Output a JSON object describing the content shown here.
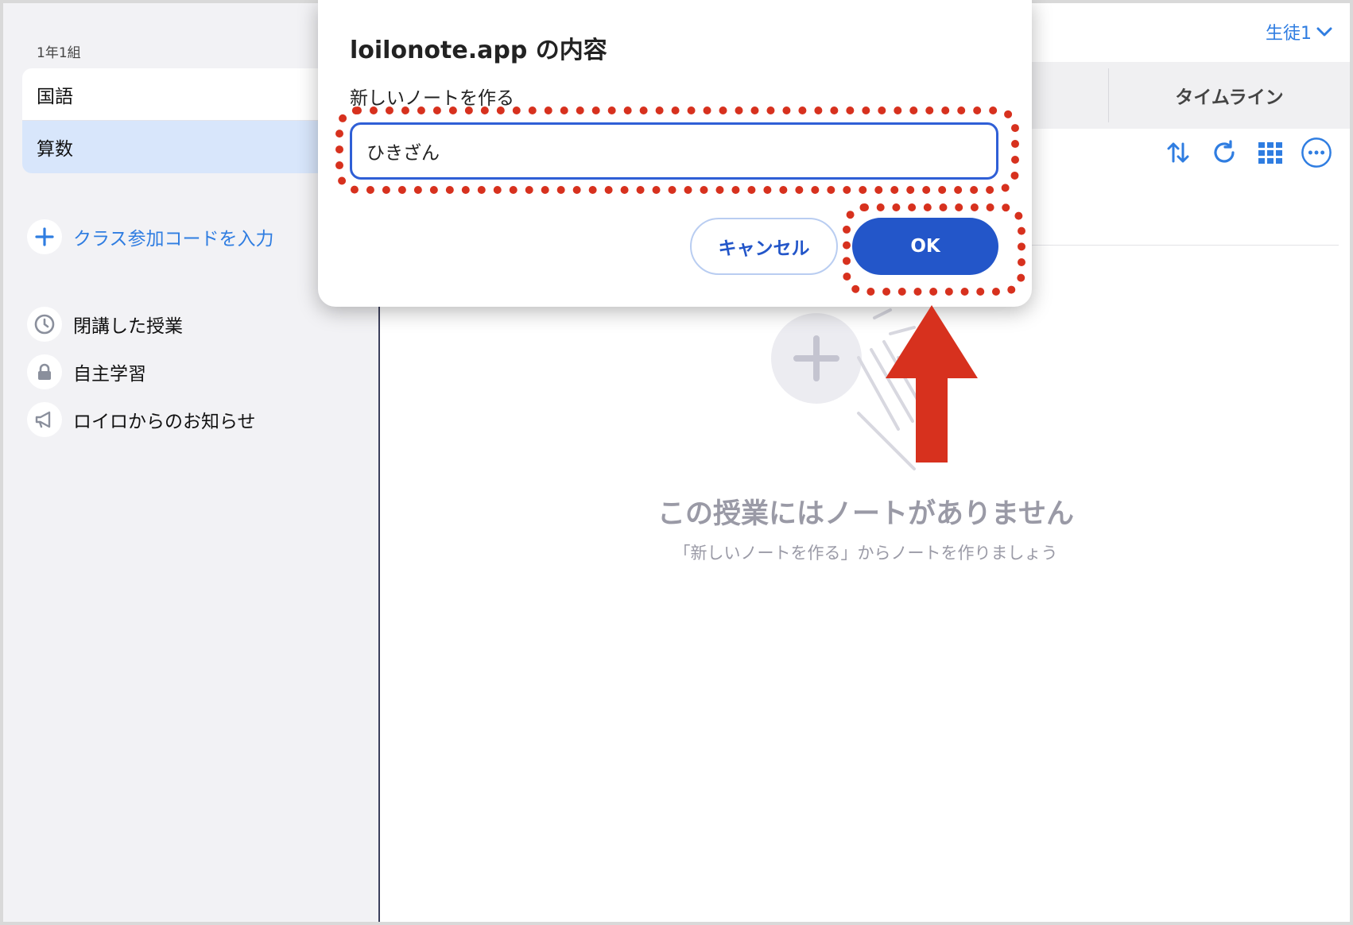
{
  "sidebar": {
    "class_name": "1年1組",
    "subjects": [
      {
        "label": "国語",
        "selected": false
      },
      {
        "label": "算数",
        "selected": true
      }
    ],
    "join_code_label": "クラス参加コードを入力",
    "nav_items": [
      {
        "label": "閉講した授業",
        "icon": "clock-icon"
      },
      {
        "label": "自主学習",
        "icon": "lock-icon"
      },
      {
        "label": "ロイロからのお知らせ",
        "icon": "megaphone-icon"
      }
    ]
  },
  "header": {
    "user_label": "生徒1",
    "tab_timeline": "タイムライン"
  },
  "empty_state": {
    "title": "この授業にはノートがありません",
    "subtitle": "「新しいノートを作る」からノートを作りましょう"
  },
  "dialog": {
    "title": "loilonote.app の内容",
    "message": "新しいノートを作る",
    "input_value": "ひきざん",
    "cancel_label": "キャンセル",
    "ok_label": "OK"
  },
  "colors": {
    "accent": "#2356c9",
    "link_blue": "#2f7de1",
    "annotation_red": "#d7311e",
    "sidebar_bg": "#f2f2f5",
    "selected_bg": "#d8e6fb"
  }
}
